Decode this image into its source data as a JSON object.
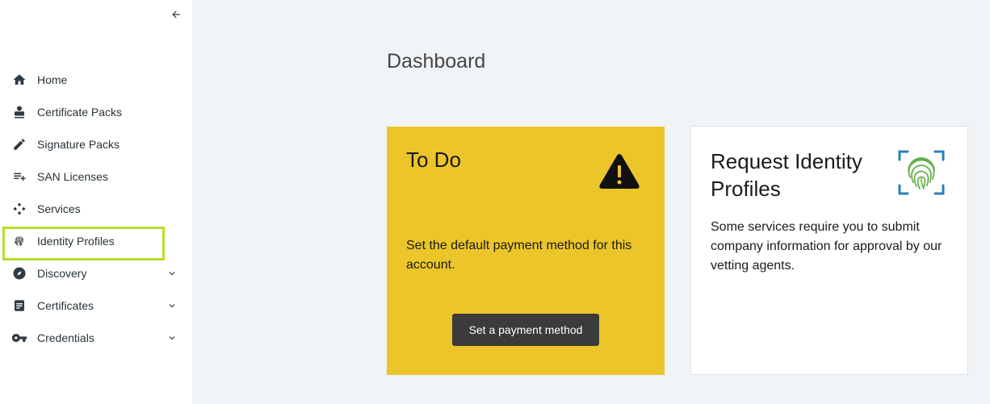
{
  "sidebar": {
    "collapse_icon": "arrow-left-icon",
    "items": [
      {
        "label": "Home",
        "icon": "home-icon"
      },
      {
        "label": "Certificate Packs",
        "icon": "stamp-icon"
      },
      {
        "label": "Signature Packs",
        "icon": "pencil-icon"
      },
      {
        "label": "SAN Licenses",
        "icon": "playlist-add-icon"
      },
      {
        "label": "Services",
        "icon": "services-icon"
      },
      {
        "label": "Identity Profiles",
        "icon": "fingerprint-icon",
        "highlighted": true
      },
      {
        "label": "Discovery",
        "icon": "compass-icon",
        "expandable": true
      },
      {
        "label": "Certificates",
        "icon": "document-icon",
        "expandable": true
      },
      {
        "label": "Credentials",
        "icon": "key-icon",
        "expandable": true
      }
    ],
    "highlight_color": "#b5e02a"
  },
  "main": {
    "title": "Dashboard",
    "todo_card": {
      "title": "To Do",
      "icon": "warning-icon",
      "description": "Set the default payment method for this account.",
      "button_label": "Set a payment method",
      "background": "#ecc52b"
    },
    "request_card": {
      "title": "Request Identity Profiles",
      "icon": "fingerprint-scan-icon",
      "description": "Some services require you to submit company information for approval by our vetting agents."
    }
  }
}
